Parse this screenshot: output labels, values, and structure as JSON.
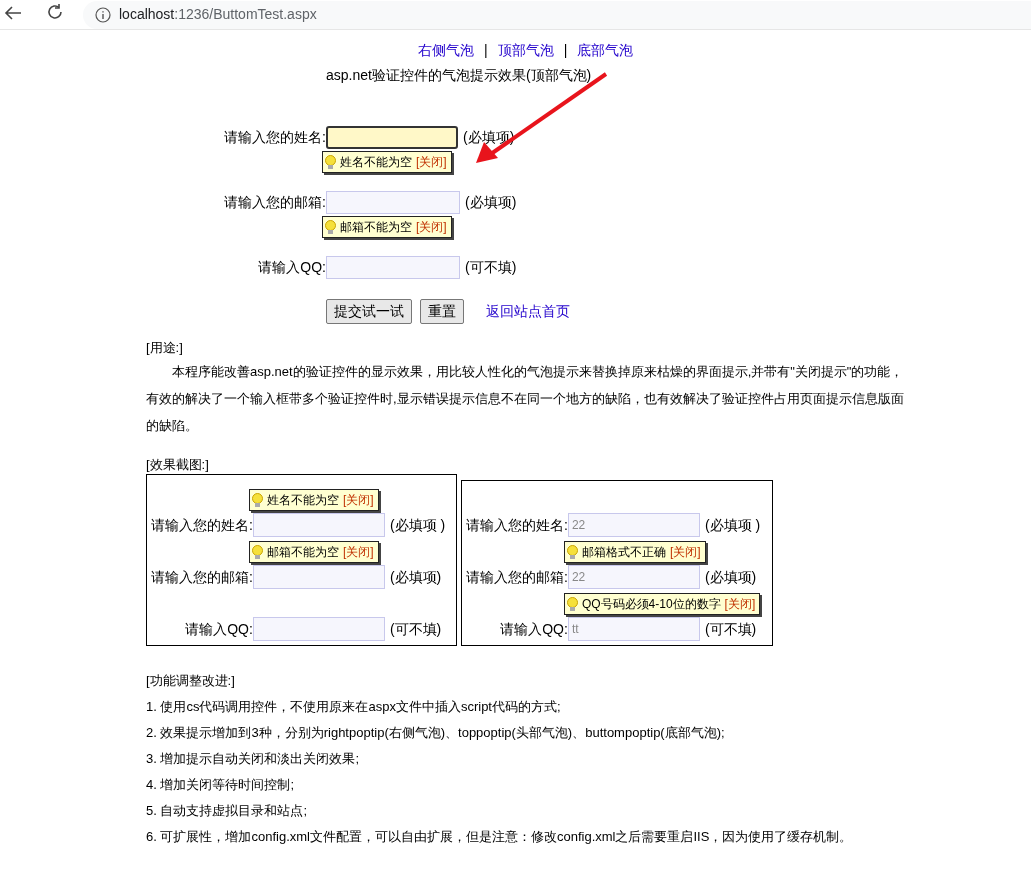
{
  "browser": {
    "host": "localhost",
    "path": ":1236/ButtomTest.aspx"
  },
  "nav_links": [
    {
      "label": "右侧气泡"
    },
    {
      "separator": "|"
    },
    {
      "label": "顶部气泡"
    },
    {
      "separator": "|"
    },
    {
      "label": "底部气泡"
    }
  ],
  "heading": "asp.net验证控件的气泡提示效果(顶部气泡)",
  "form": {
    "fields": [
      {
        "label": "请输入您的姓名:",
        "note": "(必填项)",
        "focused": true,
        "tip": {
          "text": "姓名不能为空",
          "close": "[关闭]"
        }
      },
      {
        "label": "请输入您的邮箱:",
        "note": "(必填项)",
        "focused": false,
        "tip": {
          "text": "邮箱不能为空",
          "close": "[关闭]"
        }
      },
      {
        "label": "请输入QQ:",
        "note": "(可不填)",
        "focused": false
      }
    ],
    "buttons": [
      "提交试一试",
      "重置"
    ],
    "home_link": "返回站点首页"
  },
  "usage": {
    "title": "[用途:]",
    "paragraph": "本程序能改善asp.net的验证控件的显示效果，用比较人性化的气泡提示来替换掉原来枯燥的界面提示,并带有\"关闭提示\"的功能，有效的解决了一个输入框带多个验证控件时,显示错误提示信息不在同一个地方的缺陷，也有效解决了验证控件占用页面提示信息版面的缺陷。"
  },
  "screenshots": {
    "title": "[效果截图:]",
    "panels": [
      {
        "rows": [
          {
            "label": "请输入您的姓名:",
            "note": "(必填项 )",
            "tip": {
              "text": "姓名不能为空",
              "close": "[关闭]"
            }
          },
          {
            "label": "请输入您的邮箱:",
            "note": "(必填项)",
            "tip": {
              "text": "邮箱不能为空",
              "close": "[关闭]"
            }
          },
          {
            "label": "请输入QQ:",
            "note": "(可不填)"
          }
        ]
      },
      {
        "rows": [
          {
            "label": "请输入您的姓名:",
            "value": "22",
            "note": "(必填项 )"
          },
          {
            "label": "请输入您的邮箱:",
            "value": "22",
            "note": "(必填项)",
            "tip": {
              "text": "邮箱格式不正确",
              "close": "[关闭]"
            }
          },
          {
            "label": "请输入QQ:",
            "value": "tt",
            "note": "(可不填)",
            "tip": {
              "text": "QQ号码必须4-10位的数字",
              "close": "[关闭]"
            }
          }
        ]
      }
    ]
  },
  "improvements": {
    "title": "[功能调整改进:]",
    "items": [
      "1. 使用cs代码调用控件，不使用原来在aspx文件中插入script代码的方式;",
      "2. 效果提示增加到3种，分别为rightpoptip(右侧气泡)、toppoptip(头部气泡)、buttompoptip(底部气泡);",
      "3. 增加提示自动关闭和淡出关闭效果;",
      "4. 增加关闭等待时间控制;",
      "5. 自动支持虚拟目录和站点;",
      "6. 可扩展性，增加config.xml文件配置，可以自由扩展，但是注意：修改config.xml之后需要重启IIS，因为使用了缓存机制。"
    ]
  }
}
